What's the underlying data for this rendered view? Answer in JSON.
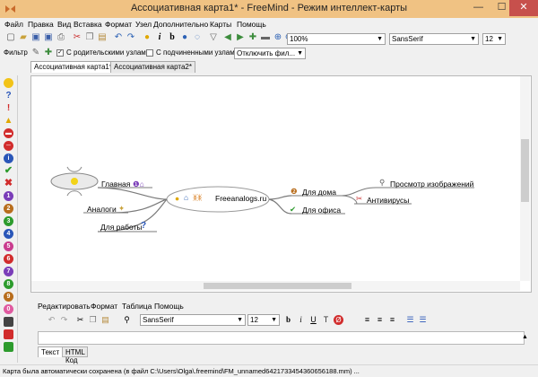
{
  "window": {
    "title": "Ассоциативная карта1* - FreeMind - Режим интеллект-карты",
    "minimize": "—",
    "maximize": "☐",
    "close": "✕"
  },
  "menu": [
    "Файл",
    "Правка",
    "Вид",
    "Вставка",
    "Формат",
    "Узел",
    "Дополнительно",
    "Карты",
    "Помощь"
  ],
  "toolbar": {
    "zoom": "100%",
    "font_family": "SansSerif",
    "font_size": "12"
  },
  "filterbar": {
    "label": "Фильтр",
    "with_parents": "С родительскими узлами",
    "with_children": "С подчиненными узлами",
    "disable_filter": "Отключить фил..."
  },
  "tabs": [
    {
      "label": "Ассоциативная карта1*"
    },
    {
      "label": "Ассоциативная карта2*"
    }
  ],
  "map": {
    "root": "Freeanalogs.ru",
    "nodes": {
      "main": "Главная",
      "analogs": "Аналоги",
      "for_work": "Для работы",
      "for_home": "Для дома",
      "for_office": "Для офиса",
      "image_viewer": "Просмотр изображений",
      "antivirus": "Антивирусы"
    }
  },
  "editor": {
    "menu": [
      "Редактировать",
      "Формат",
      "Таблица",
      "Помощь"
    ],
    "font_family": "SansSerif",
    "font_size": "12",
    "tabs": [
      "Текст",
      "HTML Код"
    ]
  },
  "status": "Карта была автоматически сохранена (в файл C:\\Users\\Olga\\.freemind\\FM_unnamed6421733454360656188.mm) ...",
  "colors": {
    "titlebar": "#f0c283",
    "close": "#c7504c",
    "edge": "#7a7a7a"
  }
}
